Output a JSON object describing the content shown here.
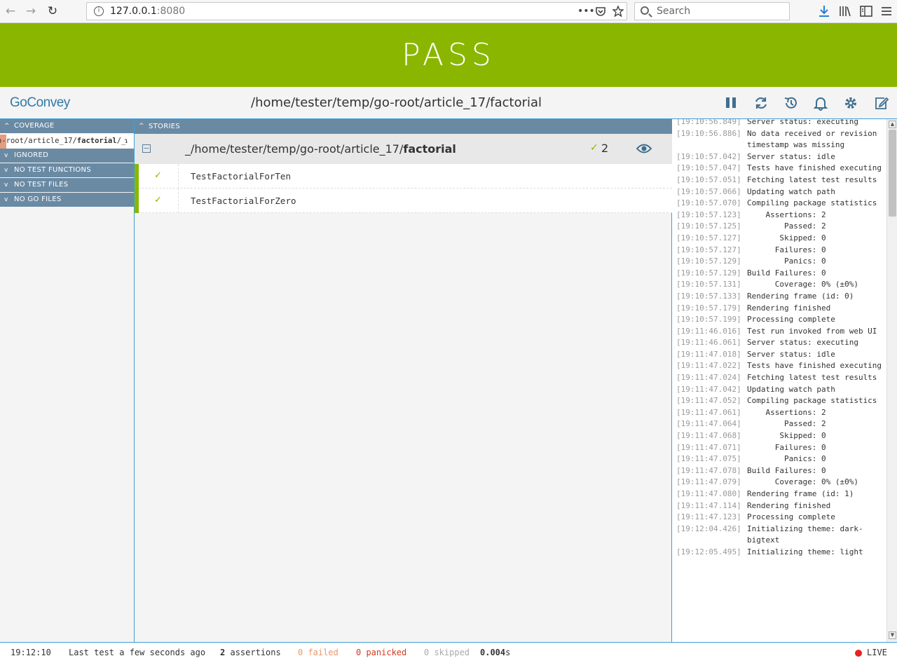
{
  "browser": {
    "url_host": "127.0.0.1",
    "url_port": ":8080",
    "search_placeholder": "Search",
    "back_glyph": "←",
    "forward_glyph": "→",
    "reload_glyph": "↻"
  },
  "banner": {
    "status": "PASS",
    "color": "#8ab600"
  },
  "header": {
    "logo": "GoConvey",
    "path": "/home/tester/temp/go-root/article_17/factorial",
    "icons": [
      "pause-icon",
      "refresh-icon",
      "history-icon",
      "bell-icon",
      "gear-icon",
      "edit-icon"
    ]
  },
  "left_panel": {
    "coverage_label": "COVERAGE",
    "coverage_item_prefix": "o-root/article_17/",
    "coverage_item_bold": "factorial",
    "coverage_item_suffix": "/_",
    "coverage_item_arrow": "↴",
    "sections": [
      "IGNORED",
      "NO TEST FUNCTIONS",
      "NO TEST FILES",
      "NO GO FILES"
    ]
  },
  "stories": {
    "header": "STORIES",
    "package_prefix": "_/home/tester/temp/go-root/article_17/",
    "package_name": "factorial",
    "pass_count": "2",
    "tests": [
      {
        "name": "TestFactorialForTen",
        "status": "pass"
      },
      {
        "name": "TestFactorialForZero",
        "status": "pass"
      }
    ]
  },
  "log": [
    {
      "ts": "[19:10:56.849]",
      "msg": "Server status: executing"
    },
    {
      "ts": "[19:10:56.886]",
      "msg": "No data received or revision timestamp was missing"
    },
    {
      "ts": "[19:10:57.042]",
      "msg": "Server status: idle"
    },
    {
      "ts": "[19:10:57.047]",
      "msg": "Tests have finished executing"
    },
    {
      "ts": "[19:10:57.051]",
      "msg": "Fetching latest test results"
    },
    {
      "ts": "[19:10:57.066]",
      "msg": "Updating watch path"
    },
    {
      "ts": "[19:10:57.070]",
      "msg": "Compiling package statistics"
    },
    {
      "ts": "[19:10:57.123]",
      "msg": "    Assertions: 2"
    },
    {
      "ts": "[19:10:57.125]",
      "msg": "        Passed: 2"
    },
    {
      "ts": "[19:10:57.127]",
      "msg": "       Skipped: 0"
    },
    {
      "ts": "[19:10:57.127]",
      "msg": "      Failures: 0"
    },
    {
      "ts": "[19:10:57.129]",
      "msg": "        Panics: 0"
    },
    {
      "ts": "[19:10:57.129]",
      "msg": "Build Failures: 0"
    },
    {
      "ts": "[19:10:57.131]",
      "msg": "      Coverage: 0% (±0%)"
    },
    {
      "ts": "[19:10:57.133]",
      "msg": "Rendering frame (id: 0)"
    },
    {
      "ts": "[19:10:57.179]",
      "msg": "Rendering finished"
    },
    {
      "ts": "[19:10:57.199]",
      "msg": "Processing complete"
    },
    {
      "ts": "[19:11:46.016]",
      "msg": "Test run invoked from web UI"
    },
    {
      "ts": "[19:11:46.061]",
      "msg": "Server status: executing"
    },
    {
      "ts": "[19:11:47.018]",
      "msg": "Server status: idle"
    },
    {
      "ts": "[19:11:47.022]",
      "msg": "Tests have finished executing"
    },
    {
      "ts": "[19:11:47.024]",
      "msg": "Fetching latest test results"
    },
    {
      "ts": "[19:11:47.042]",
      "msg": "Updating watch path"
    },
    {
      "ts": "[19:11:47.052]",
      "msg": "Compiling package statistics"
    },
    {
      "ts": "[19:11:47.061]",
      "msg": "    Assertions: 2"
    },
    {
      "ts": "[19:11:47.064]",
      "msg": "        Passed: 2"
    },
    {
      "ts": "[19:11:47.068]",
      "msg": "       Skipped: 0"
    },
    {
      "ts": "[19:11:47.071]",
      "msg": "      Failures: 0"
    },
    {
      "ts": "[19:11:47.075]",
      "msg": "        Panics: 0"
    },
    {
      "ts": "[19:11:47.078]",
      "msg": "Build Failures: 0"
    },
    {
      "ts": "[19:11:47.079]",
      "msg": "      Coverage: 0% (±0%)"
    },
    {
      "ts": "[19:11:47.080]",
      "msg": "Rendering frame (id: 1)"
    },
    {
      "ts": "[19:11:47.114]",
      "msg": "Rendering finished"
    },
    {
      "ts": "[19:11:47.123]",
      "msg": "Processing complete"
    },
    {
      "ts": "[19:12:04.426]",
      "msg": "Initializing theme: dark-bigtext"
    },
    {
      "ts": "[19:12:05.495]",
      "msg": "Initializing theme: light"
    }
  ],
  "footer": {
    "time": "19:12:10",
    "last_test": "Last test a few seconds ago",
    "assertions_count": "2",
    "assertions_label": "assertions",
    "failed": "0 failed",
    "panicked": "0 panicked",
    "skipped": "0 skipped",
    "duration_value": "0.004",
    "duration_unit": "s",
    "live": "LIVE"
  }
}
